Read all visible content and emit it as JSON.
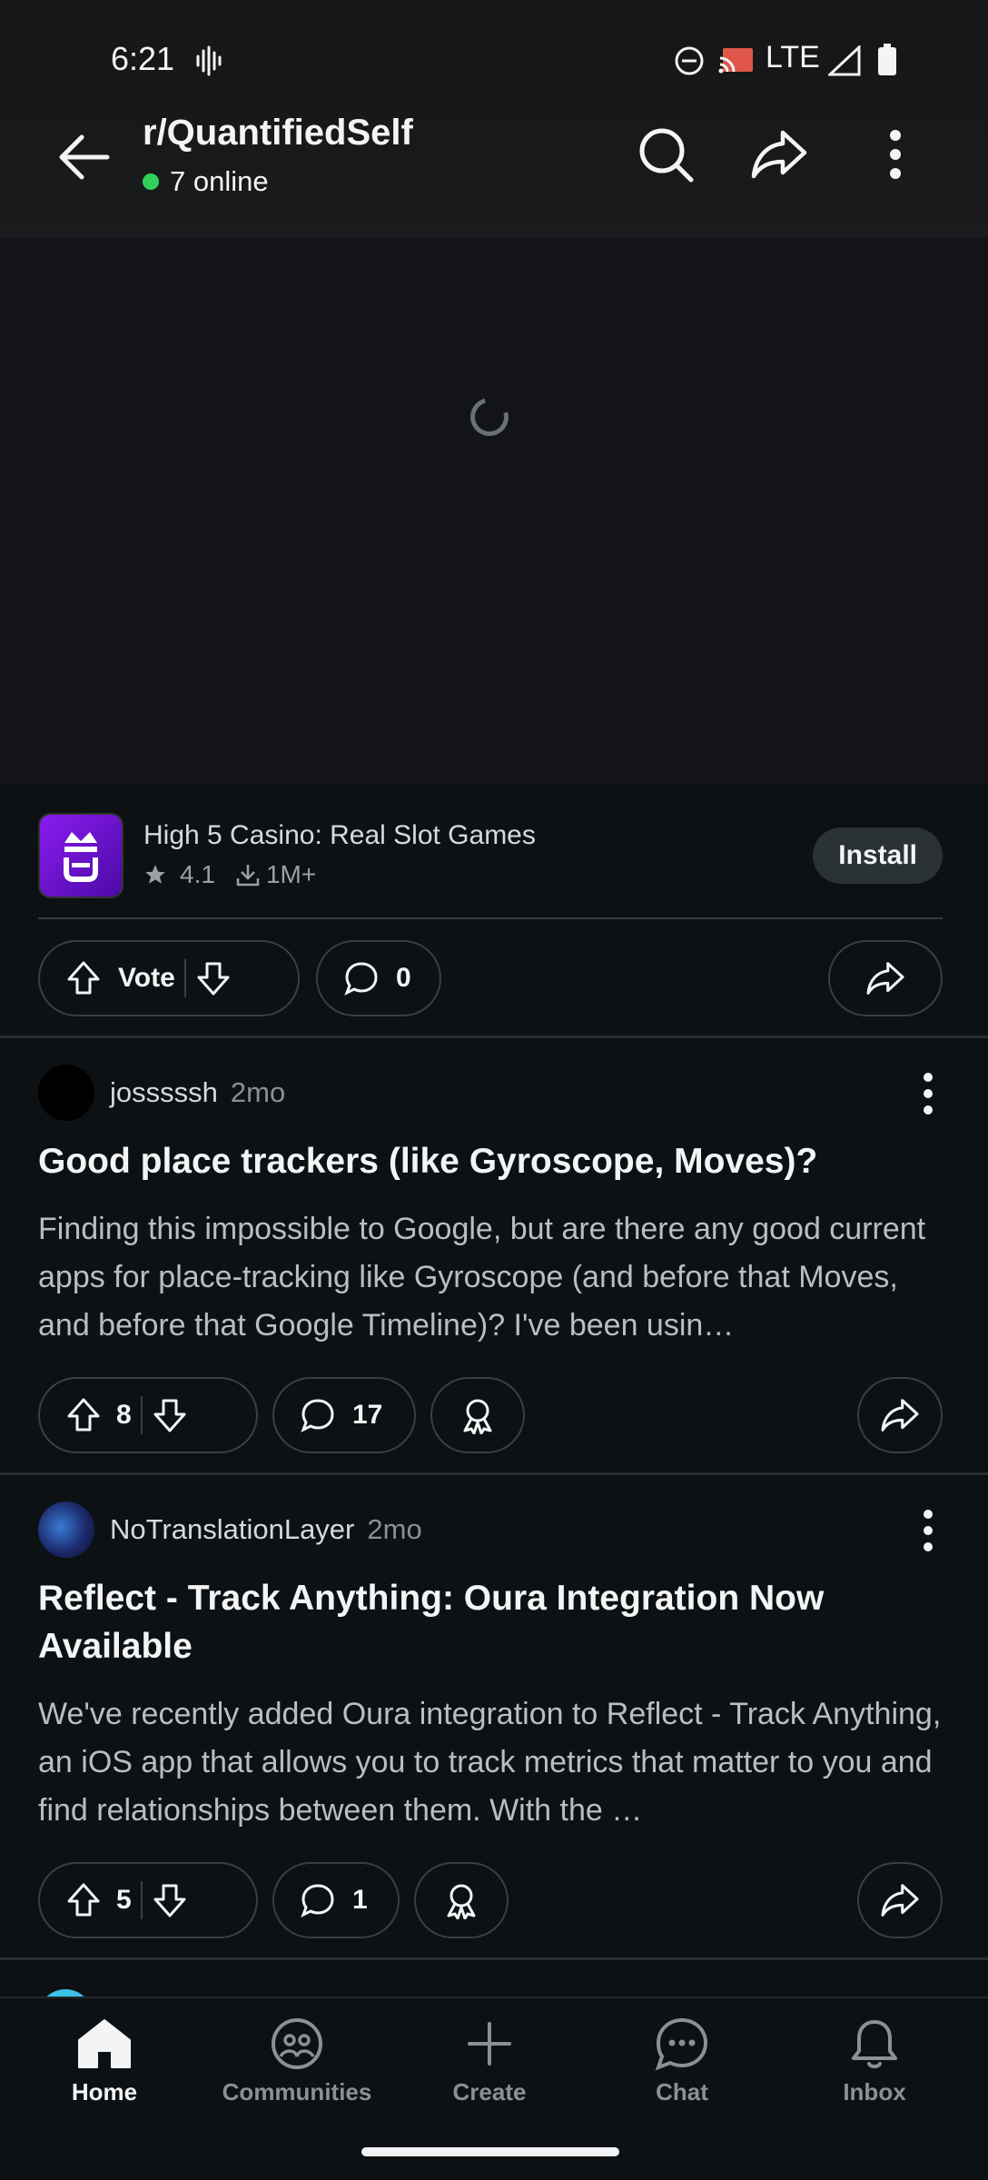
{
  "status_bar": {
    "time": "6:21",
    "network": "LTE"
  },
  "header": {
    "title": "r/QuantifiedSelf",
    "online": "7 online"
  },
  "ad": {
    "app_name": "High 5 Casino: Real Slot Games",
    "rating": "4.1",
    "downloads": "1M+",
    "install_label": "Install",
    "vote_label": "Vote",
    "comments": "0"
  },
  "posts": [
    {
      "author": "josssssh",
      "time": "2mo",
      "title": "Good place trackers (like Gyroscope, Moves)?",
      "body": "Finding this impossible to Google, but are there any good current apps for place-tracking like Gyroscope (and before that Moves, and before that Google Timeline)? I've been usin…",
      "votes": "8",
      "comments": "17"
    },
    {
      "author": "NoTranslationLayer",
      "time": "2mo",
      "title": "Reflect - Track Anything: Oura Integration Now Available",
      "body": "We've recently added Oura integration to Reflect - Track Anything, an iOS app that allows you to track metrics that matter to you and find relationships between them. With the …",
      "votes": "5",
      "comments": "1"
    }
  ],
  "bottom_nav": [
    {
      "label": "Home",
      "icon": "home-icon",
      "active": true
    },
    {
      "label": "Communities",
      "icon": "communities-icon"
    },
    {
      "label": "Create",
      "icon": "plus-icon"
    },
    {
      "label": "Chat",
      "icon": "chat-icon"
    },
    {
      "label": "Inbox",
      "icon": "bell-icon"
    }
  ],
  "colors": {
    "background": "#0e1113",
    "online": "#2fd15a",
    "accent_app": "#8a1cf0"
  }
}
